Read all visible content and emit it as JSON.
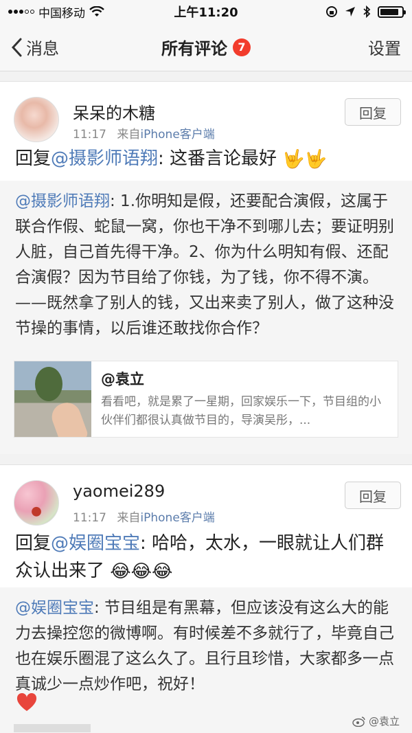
{
  "status_bar": {
    "carrier": "中国移动",
    "time": "上午11:20",
    "battery_level": 0.85
  },
  "nav": {
    "back_label": "消息",
    "title": "所有评论",
    "badge_count": "7",
    "settings_label": "设置"
  },
  "comments": [
    {
      "username": "呆呆的木糖",
      "time": "11:17",
      "source_prefix": "来自",
      "source": "iPhone客户端",
      "reply_button": "回复",
      "reply_prefix": "回复",
      "reply_mention": "@摄影师语翔",
      "reply_text": ": 这番言论最好",
      "reply_emojis": "🤟🤟",
      "quote_mention": "@摄影师语翔",
      "quote_text": ": 1.你明知是假，还要配合演假，这属于联合作假、蛇鼠一窝，你也干净不到哪儿去；要证明别人脏，自己首先得干净。2、你为什么明知有假、还配合演假？因为节目给了你钱，为了钱，你不得不演。——既然拿了别人的钱，又出来卖了别人，做了这种没节操的事情，以后谁还敢找你合作？",
      "original": {
        "name": "@袁立",
        "text": "看看吧，就是累了一星期，回家娱乐一下，节目组的小伙伴们都很认真做节目的，导演吴彤，..."
      }
    },
    {
      "username": "yaomei289",
      "time": "11:17",
      "source_prefix": "来自",
      "source": "iPhone客户端",
      "reply_button": "回复",
      "reply_prefix": "回复",
      "reply_mention": "@娱圈宝宝",
      "reply_text": ": 哈哈，太水，一眼就让人们群众认出来了",
      "reply_emojis": "😂😂😂",
      "quote_mention": "@娱圈宝宝",
      "quote_text": ": 节目组是有黑幕，但应该没有这么大的能力去操控您的微博啊。有时候差不多就行了，毕竟自己也在娱乐圈混了这么久了。且行且珍惜，大家都多一点真诚少一点炒作吧，祝好！"
    }
  ],
  "watermark": "@袁立",
  "colors": {
    "mention": "#4f7bb8",
    "badge": "#f23c2c",
    "heart": "#e8453c"
  }
}
